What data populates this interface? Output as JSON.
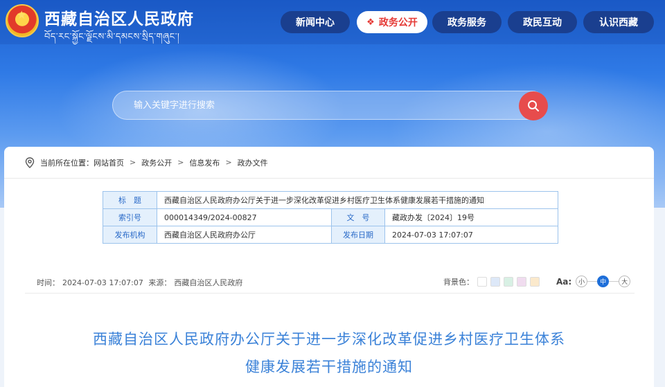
{
  "header": {
    "site_title": "西藏自治区人民政府",
    "site_subtitle": "བོད་རང་སྐྱོང་ལྗོངས་མི་དམངས་སྲིད་གཞུང་།",
    "nav": [
      {
        "label": "新闻中心"
      },
      {
        "label": "政务公开"
      },
      {
        "label": "政务服务"
      },
      {
        "label": "政民互动"
      },
      {
        "label": "认识西藏"
      }
    ],
    "active_nav": "政务公开",
    "accent_color": "#e53935",
    "nav_bg_color": "#1a3f8f"
  },
  "search": {
    "placeholder": "输入关键字进行搜索",
    "button_color": "#e74c4c"
  },
  "breadcrumb": {
    "prefix": "当前所在位置：",
    "items": [
      "网站首页",
      "政务公开",
      "信息发布",
      "政办文件"
    ]
  },
  "meta": {
    "title_label": "标　题",
    "title_value": "西藏自治区人民政府办公厅关于进一步深化改革促进乡村医疗卫生体系健康发展若干措施的通知",
    "index_label": "索引号",
    "index_value": "000014349/2024-00827",
    "docno_label": "文　号",
    "docno_value": "藏政办发〔2024〕19号",
    "issuer_label": "发布机构",
    "issuer_value": "西藏自治区人民政府办公厅",
    "date_label": "发布日期",
    "date_value": "2024-07-03 17:07:07"
  },
  "info": {
    "time_label": "时间：",
    "time_value": "2024-07-03 17:07:07",
    "source_label": "来源：",
    "source_value": "西藏自治区人民政府",
    "bg_label": "背景色：",
    "bg_colors": [
      "#ffffff",
      "#dde8f8",
      "#d8f0e4",
      "#f0dcef",
      "#fbe9cc"
    ],
    "font_icon_label": "Aa:",
    "font_sizes": [
      "小",
      "中",
      "大"
    ],
    "active_font_size": "中"
  },
  "doc": {
    "title_line1": "西藏自治区人民政府办公厅关于进一步深化改革促进乡村医疗卫生体系",
    "title_line2": "健康发展若干措施的通知"
  }
}
